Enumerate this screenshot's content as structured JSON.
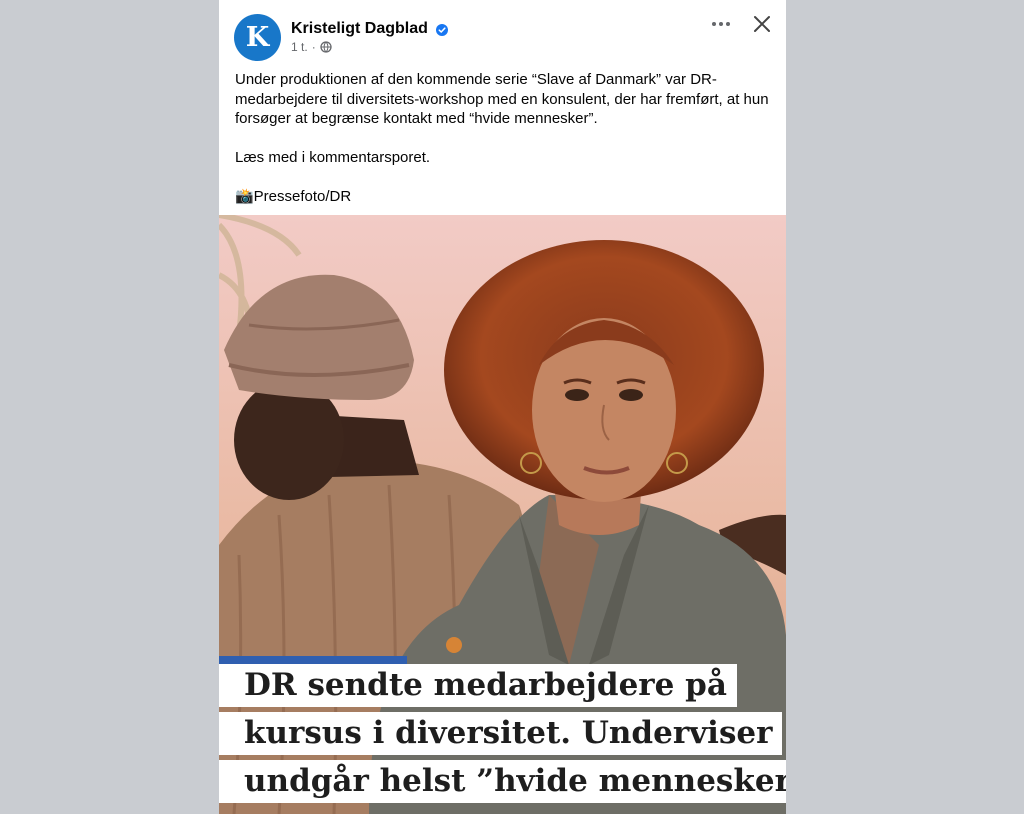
{
  "post": {
    "page_name": "Kristeligt Dagblad",
    "avatar_letter": "K",
    "time": "1 t.",
    "separator": "·",
    "more_icon": "ellipsis-icon",
    "close_icon": "close-icon",
    "caption": [
      "Under produktionen af den kommende serie “Slave af Danmark” var DR-medarbejdere til diversitets-workshop med en konsulent, der har fremført, at hun forsøger at begrænse kontakt med “hvide mennesker”.",
      "Læs med i kommentarsporet.",
      "📸Pressefoto/DR"
    ]
  },
  "article": {
    "headline_lines": [
      "DR sendte medarbejdere på",
      "kursus i diversitet. Underviser",
      "undgår helst ”hvide mennesker”"
    ]
  },
  "colors": {
    "brand_blue": "#1877c9",
    "accent_bar": "#2f5fb0",
    "backdrop": "#c9ccd1"
  }
}
